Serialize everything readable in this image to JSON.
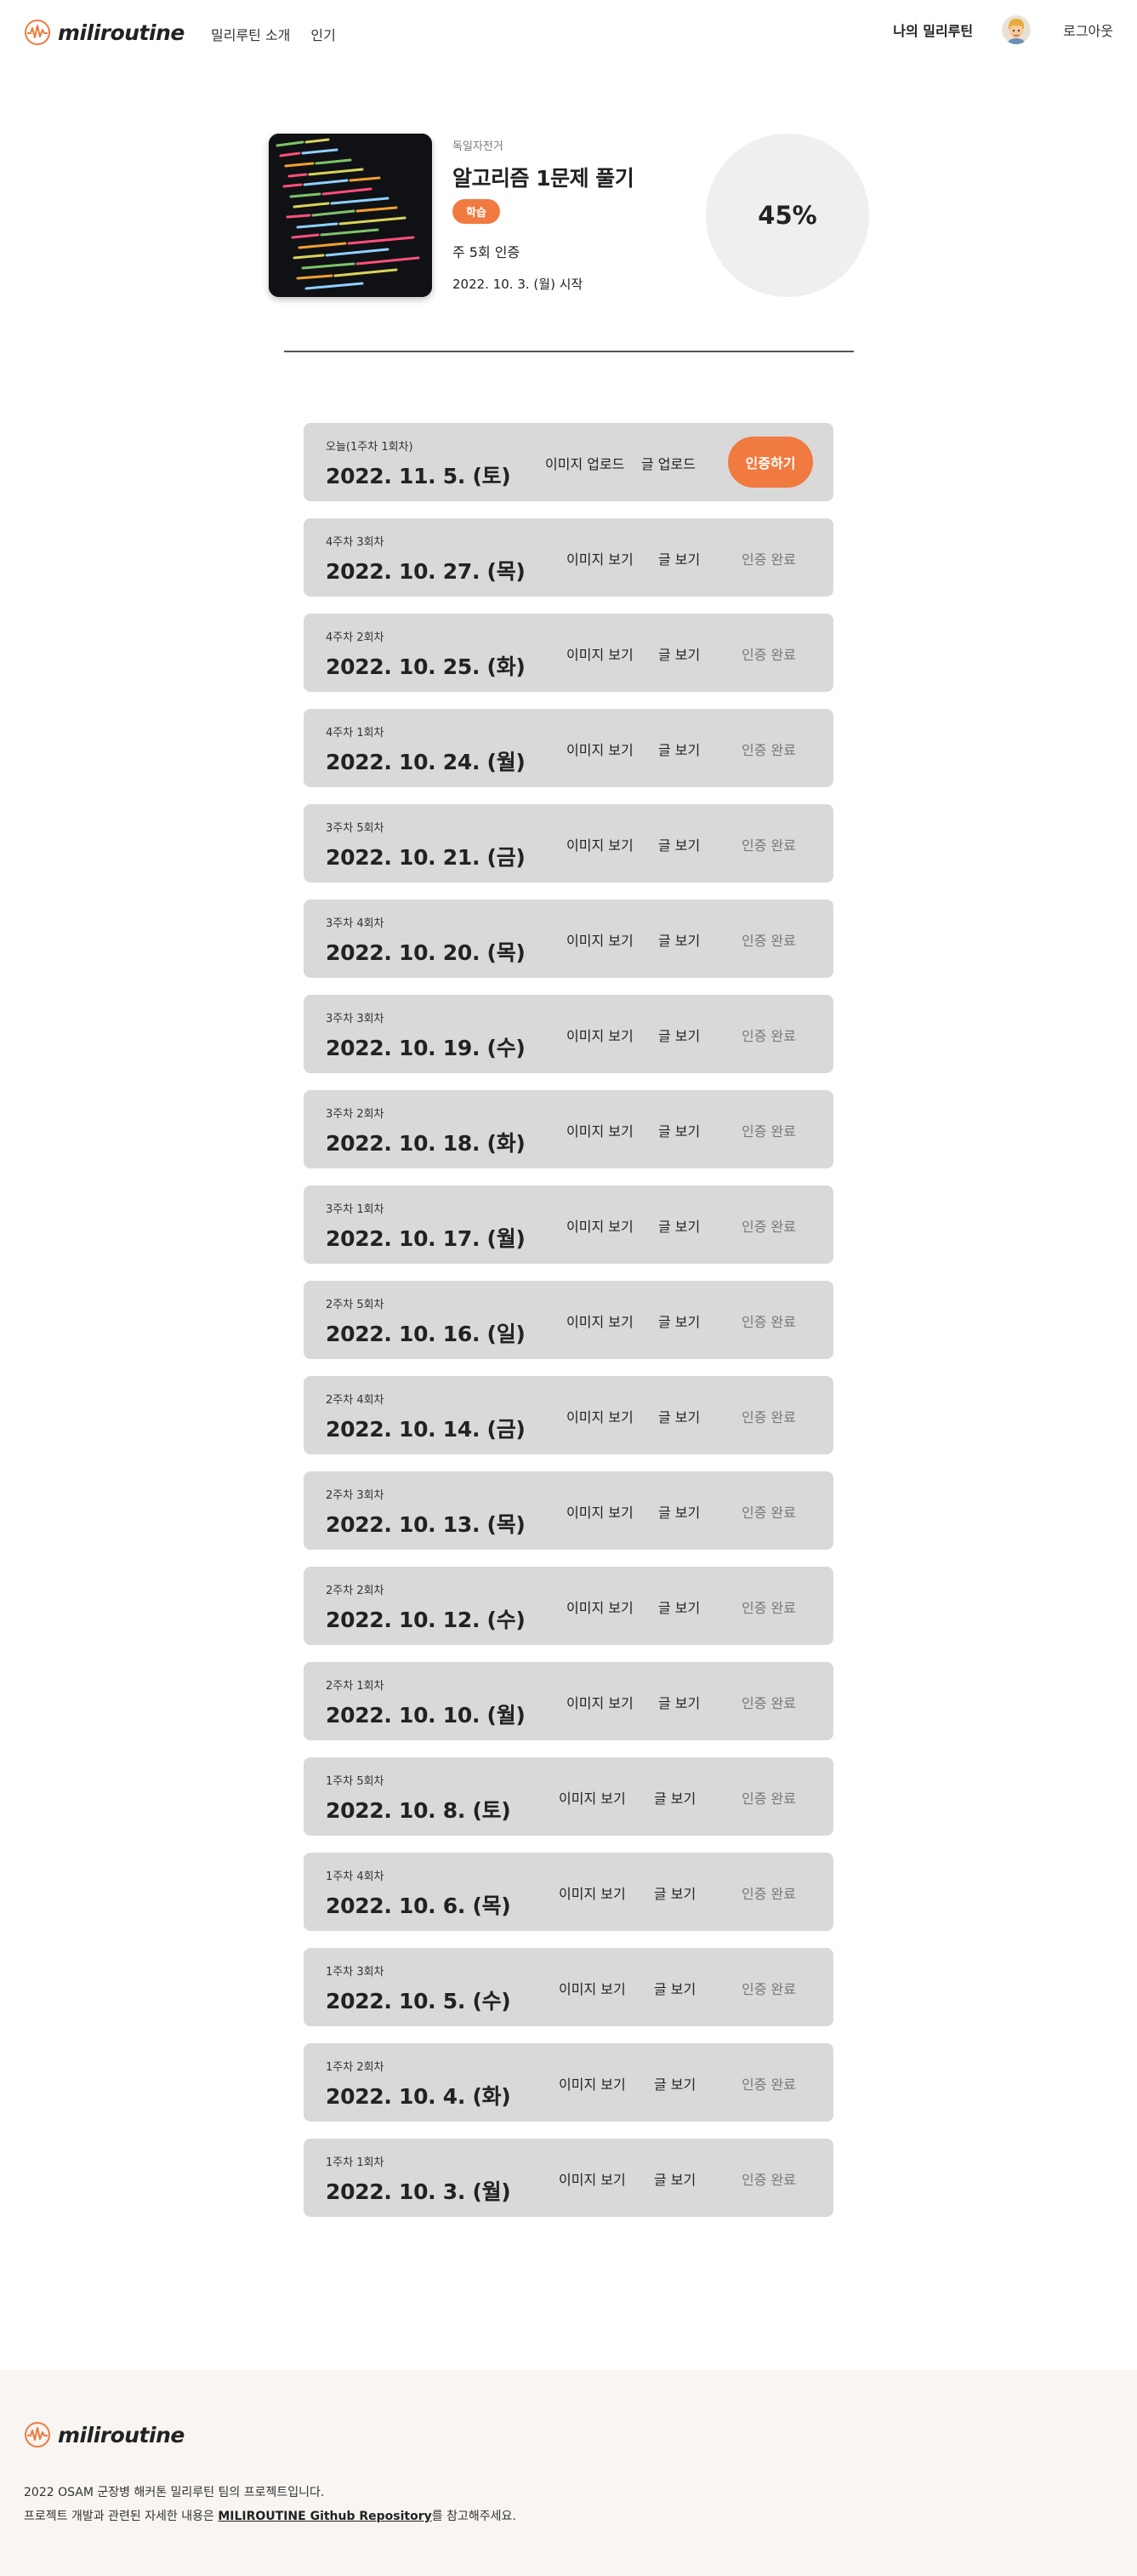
{
  "header": {
    "logo_text": "miliroutine",
    "nav": [
      "밀리루틴 소개",
      "인기"
    ],
    "my_routine": "나의 밀리루틴",
    "logout": "로그아웃"
  },
  "routine": {
    "category": "독일자전거",
    "title": "알고리즘 1문제 풀기",
    "tag": "학습",
    "frequency": "주 5회 인증",
    "start_date": "2022. 10. 3. (월) 시작",
    "progress": "45%"
  },
  "today_row": {
    "round": "오늘(1주차 1회차)",
    "date": "2022. 11. 5. (토)",
    "image_action": "이미지 업로드",
    "text_action": "글 업로드",
    "certify_button": "인증하기"
  },
  "rows": [
    {
      "round": "4주차 3회차",
      "date": "2022. 10. 27. (목)",
      "image_action": "이미지 보기",
      "text_action": "글 보기",
      "status": "인증 완료"
    },
    {
      "round": "4주차 2회차",
      "date": "2022. 10. 25. (화)",
      "image_action": "이미지 보기",
      "text_action": "글 보기",
      "status": "인증 완료"
    },
    {
      "round": "4주차 1회차",
      "date": "2022. 10. 24. (월)",
      "image_action": "이미지 보기",
      "text_action": "글 보기",
      "status": "인증 완료"
    },
    {
      "round": "3주차 5회차",
      "date": "2022. 10. 21. (금)",
      "image_action": "이미지 보기",
      "text_action": "글 보기",
      "status": "인증 완료"
    },
    {
      "round": "3주차 4회차",
      "date": "2022. 10. 20. (목)",
      "image_action": "이미지 보기",
      "text_action": "글 보기",
      "status": "인증 완료"
    },
    {
      "round": "3주차 3회차",
      "date": "2022. 10. 19. (수)",
      "image_action": "이미지 보기",
      "text_action": "글 보기",
      "status": "인증 완료"
    },
    {
      "round": "3주차 2회차",
      "date": "2022. 10. 18. (화)",
      "image_action": "이미지 보기",
      "text_action": "글 보기",
      "status": "인증 완료"
    },
    {
      "round": "3주차 1회차",
      "date": "2022. 10. 17. (월)",
      "image_action": "이미지 보기",
      "text_action": "글 보기",
      "status": "인증 완료"
    },
    {
      "round": "2주차 5회차",
      "date": "2022. 10. 16. (일)",
      "image_action": "이미지 보기",
      "text_action": "글 보기",
      "status": "인증 완료"
    },
    {
      "round": "2주차 4회차",
      "date": "2022. 10. 14. (금)",
      "image_action": "이미지 보기",
      "text_action": "글 보기",
      "status": "인증 완료"
    },
    {
      "round": "2주차 3회차",
      "date": "2022. 10. 13. (목)",
      "image_action": "이미지 보기",
      "text_action": "글 보기",
      "status": "인증 완료"
    },
    {
      "round": "2주차 2회차",
      "date": "2022. 10. 12. (수)",
      "image_action": "이미지 보기",
      "text_action": "글 보기",
      "status": "인증 완료"
    },
    {
      "round": "2주차 1회차",
      "date": "2022. 10. 10. (월)",
      "image_action": "이미지 보기",
      "text_action": "글 보기",
      "status": "인증 완료"
    },
    {
      "round": "1주차 5회차",
      "date": "2022. 10. 8. (토)",
      "image_action": "이미지 보기",
      "text_action": "글 보기",
      "status": "인증 완료"
    },
    {
      "round": "1주차 4회차",
      "date": "2022. 10. 6. (목)",
      "image_action": "이미지 보기",
      "text_action": "글 보기",
      "status": "인증 완료"
    },
    {
      "round": "1주차 3회차",
      "date": "2022. 10. 5. (수)",
      "image_action": "이미지 보기",
      "text_action": "글 보기",
      "status": "인증 완료"
    },
    {
      "round": "1주차 2회차",
      "date": "2022. 10. 4. (화)",
      "image_action": "이미지 보기",
      "text_action": "글 보기",
      "status": "인증 완료"
    },
    {
      "round": "1주차 1회차",
      "date": "2022. 10. 3. (월)",
      "image_action": "이미지 보기",
      "text_action": "글 보기",
      "status": "인증 완료"
    }
  ],
  "footer": {
    "logo_text": "miliroutine",
    "line1": "2022 OSAM 군장병 해커톤 밀리루틴 팀의 프로젝트입니다.",
    "line2_prefix": "프로젝트 개발과 관련된 자세한 내용은 ",
    "line2_link": "MILIROUTINE Github Repository",
    "line2_suffix": "를 참고해주세요."
  },
  "colors": {
    "accent": "#f07a3f",
    "row_bg": "#d9d9d9",
    "footer_bg": "#f8f5f2"
  }
}
